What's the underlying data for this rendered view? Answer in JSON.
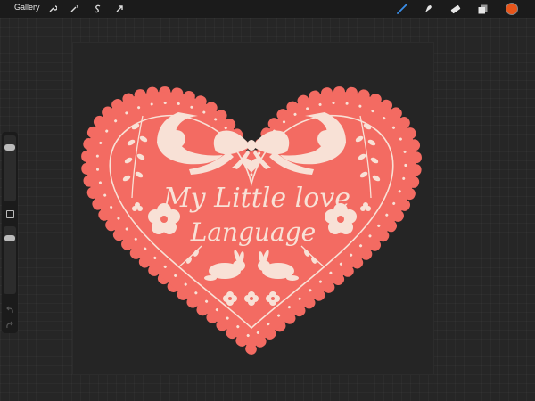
{
  "topbar": {
    "gallery_label": "Gallery",
    "left_tools": [
      "wrench-icon",
      "magic-wand-icon",
      "selection-icon",
      "transform-arrow-icon"
    ],
    "right_tools": [
      "brush-icon",
      "smudge-icon",
      "eraser-icon",
      "layers-icon"
    ],
    "current_color": "#e8551a",
    "active_tool_color": "#3a8ee8"
  },
  "sidebar": {
    "brush_size_level": 0.15,
    "opacity_level": 0.15,
    "tools": [
      "modify-square-icon",
      "undo-icon",
      "redo-icon"
    ]
  },
  "artwork": {
    "text_line1": "My Little love",
    "text_line2": "Language",
    "heart_color": "#f36b62",
    "cream_color": "#f8e1d6"
  }
}
